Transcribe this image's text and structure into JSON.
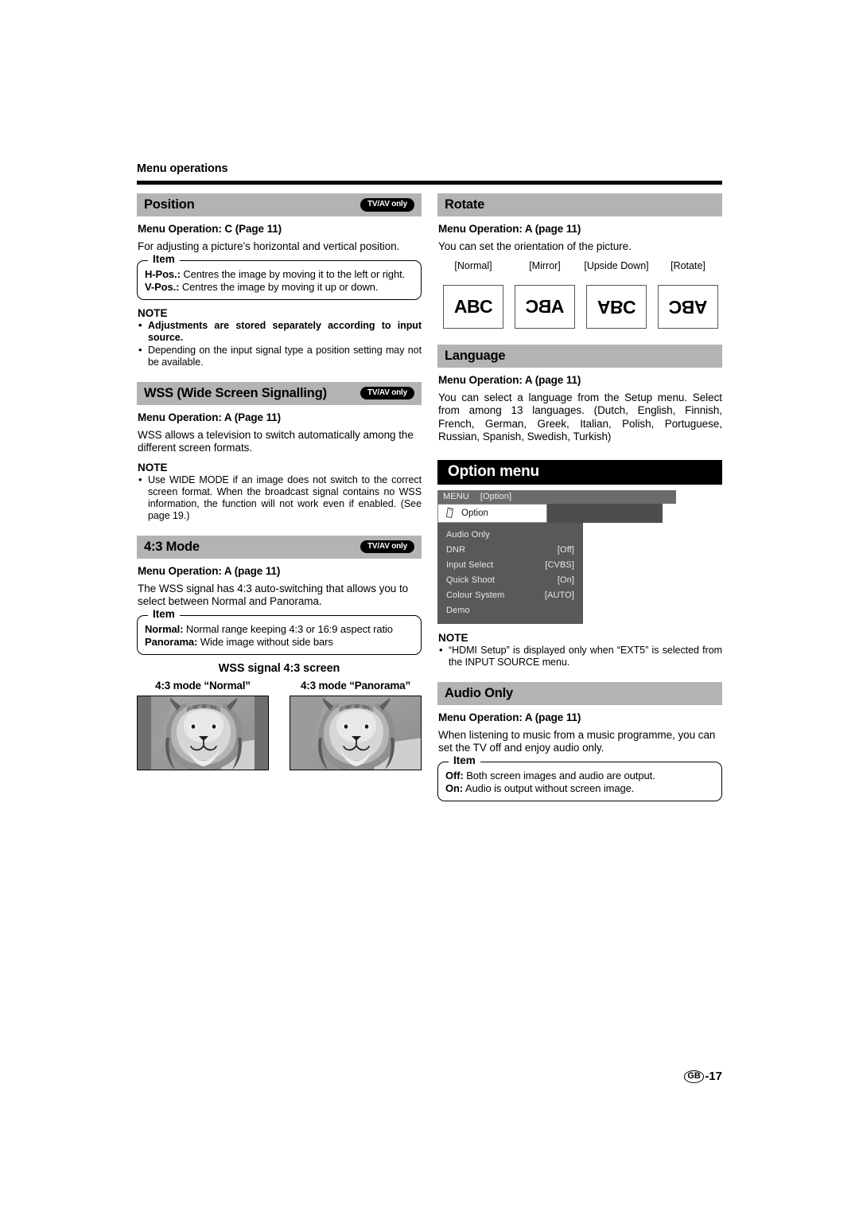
{
  "running_head": "Menu operations",
  "footer": {
    "region_code": "GB",
    "page_number": "-17"
  },
  "badges": {
    "tv_av_only": "TV/AV only"
  },
  "labels": {
    "item_legend": "Item",
    "note_heading": "NOTE"
  },
  "left_column": {
    "position": {
      "heading": "Position",
      "badge": "TV/AV only",
      "menu_operation": "Menu Operation: C (Page 11)",
      "description": "For adjusting a picture’s horizontal and vertical position.",
      "item_legend": "Item",
      "items": [
        {
          "term": "H-Pos.:",
          "definition": " Centres the image by moving it to the left or right."
        },
        {
          "term": "V-Pos.:",
          "definition": " Centres the image by moving it up or down."
        }
      ],
      "note_heading": "NOTE",
      "notes": [
        {
          "text": "Adjustments are stored separately according to input source.",
          "bold": true
        },
        {
          "text": "Depending on the input signal type a position setting may not be available.",
          "bold": false
        }
      ]
    },
    "wss": {
      "heading": "WSS (Wide Screen Signalling)",
      "badge": "TV/AV only",
      "menu_operation": "Menu Operation: A (Page 11)",
      "description": "WSS allows a television to switch automatically among the different screen formats.",
      "note_heading": "NOTE",
      "notes": [
        {
          "text": "Use WIDE MODE if an image does not switch to the correct screen format. When the broadcast signal contains no WSS information, the function will not work even if enabled. (See page 19.)",
          "bold": false
        }
      ]
    },
    "mode43": {
      "heading": "4:3 Mode",
      "badge": "TV/AV only",
      "menu_operation": "Menu Operation: A (page 11)",
      "description": "The WSS signal has 4:3 auto-switching that allows you to select between Normal and Panorama.",
      "item_legend": "Item",
      "items": [
        {
          "term": "Normal:",
          "definition": " Normal range keeping 4:3 or 16:9 aspect ratio"
        },
        {
          "term": "Panorama:",
          "definition": " Wide image without side bars"
        }
      ],
      "figure": {
        "title": "WSS signal 4:3 screen",
        "examples": [
          {
            "caption": "4:3 mode “Normal”",
            "has_side_bars": true
          },
          {
            "caption": "4:3 mode “Panorama”",
            "has_side_bars": false
          }
        ]
      }
    }
  },
  "right_column": {
    "rotate": {
      "heading": "Rotate",
      "menu_operation": "Menu Operation: A (page 11)",
      "description": "You can set the orientation of the picture.",
      "orientations": [
        {
          "label": "[Normal]",
          "text": "ABC",
          "transform": "normal"
        },
        {
          "label": "[Mirror]",
          "text": "ABC",
          "transform": "mirror"
        },
        {
          "label": "[Upside Down]",
          "text": "ABC",
          "transform": "upside-down"
        },
        {
          "label": "[Rotate]",
          "text": "ABC",
          "transform": "rotate"
        }
      ]
    },
    "language": {
      "heading": "Language",
      "menu_operation": "Menu Operation: A (page 11)",
      "description": "You can select a language from the Setup menu. Select from among 13 languages. (Dutch, English, Finnish, French, German, Greek, Italian, Polish, Portuguese, Russian, Spanish, Swedish, Turkish)"
    },
    "option_menu": {
      "banner": "Option menu",
      "osd": {
        "menu_label": "MENU",
        "menu_context": "[Option]",
        "active_tab": "Option",
        "tab_icon": "option-card-icon",
        "items": [
          {
            "label": "Audio Only",
            "value": ""
          },
          {
            "label": "DNR",
            "value": "[Off]"
          },
          {
            "label": "Input Select",
            "value": "[CVBS]"
          },
          {
            "label": "Quick Shoot",
            "value": "[On]"
          },
          {
            "label": "Colour System",
            "value": "[AUTO]"
          },
          {
            "label": "Demo",
            "value": ""
          }
        ]
      },
      "note_heading": "NOTE",
      "notes": [
        {
          "text": "“HDMI Setup” is displayed only when “EXT5” is selected from the INPUT SOURCE menu.",
          "bold": false
        }
      ]
    },
    "audio_only": {
      "heading": "Audio Only",
      "menu_operation": "Menu Operation: A (page 11)",
      "description": "When listening to music from a music programme, you can set the TV off and enjoy audio only.",
      "item_legend": "Item",
      "items": [
        {
          "term": "Off:",
          "definition": " Both screen images and audio are output."
        },
        {
          "term": "On:",
          "definition": " Audio is output without screen image."
        }
      ]
    }
  }
}
